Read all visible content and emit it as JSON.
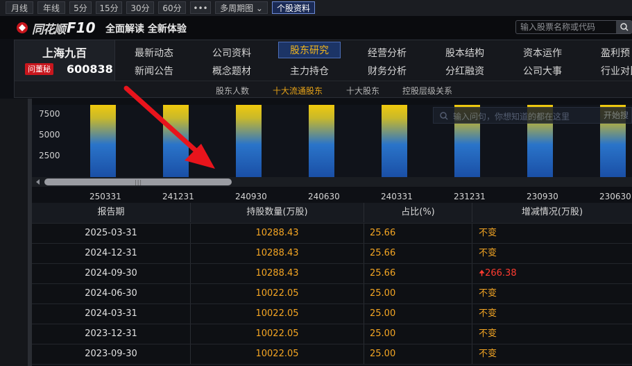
{
  "toolbar": {
    "buttons": [
      {
        "label": "月线"
      },
      {
        "label": "年线"
      },
      {
        "label": "5分"
      },
      {
        "label": "15分"
      },
      {
        "label": "30分"
      },
      {
        "label": "60分"
      },
      {
        "label": "•••"
      },
      {
        "label": "多周期图 ⌄"
      },
      {
        "label": "个股资料"
      }
    ]
  },
  "header": {
    "logo_name": "同花顺",
    "logo_f10": "F10",
    "slogan": "全面解读 全新体验",
    "search_placeholder": "输入股票名称或代码"
  },
  "stock": {
    "name": "上海九百",
    "badge": "问董秘",
    "code": "600838"
  },
  "nav": {
    "row1": [
      "最新动态",
      "公司资料",
      "股东研究",
      "经营分析",
      "股本结构",
      "资本运作",
      "盈利预"
    ],
    "row2": [
      "新闻公告",
      "概念题材",
      "主力持仓",
      "财务分析",
      "分红融资",
      "公司大事",
      "行业对比"
    ],
    "active": "股东研究"
  },
  "subnav": {
    "items": [
      "股东人数",
      "十大流通股东",
      "十大股东",
      "控股层级关系"
    ],
    "active": "十大流通股东"
  },
  "ask": {
    "placeholder": "输入问句，你想知道的都在这里",
    "button": "开始搜"
  },
  "chart_data": {
    "type": "bar",
    "categories": [
      "250331",
      "241231",
      "240930",
      "240630",
      "240331",
      "231231",
      "230930",
      "230630"
    ],
    "y_ticks": [
      "7500",
      "5000",
      "2500"
    ]
  },
  "table": {
    "headers": [
      "报告期",
      "持股数量(万股)",
      "占比(%)",
      "增减情况(万股)"
    ],
    "rows": [
      [
        "2025-03-31",
        "10288.43",
        "25.66",
        "不变"
      ],
      [
        "2024-12-31",
        "10288.43",
        "25.66",
        "不变"
      ],
      [
        "2024-09-30",
        "10288.43",
        "25.66",
        "266.38"
      ],
      [
        "2024-06-30",
        "10022.05",
        "25.00",
        "不变"
      ],
      [
        "2024-03-31",
        "10022.05",
        "25.00",
        "不变"
      ],
      [
        "2023-12-31",
        "10022.05",
        "25.00",
        "不变"
      ],
      [
        "2023-09-30",
        "10022.05",
        "25.00",
        "不变"
      ]
    ]
  },
  "colors": {
    "accent_orange": "#f5a623",
    "up_red": "#ff3b30",
    "active_nav_bg": "#1c3466"
  }
}
